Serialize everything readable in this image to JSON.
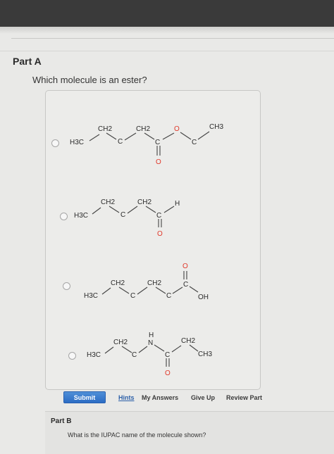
{
  "part_a": {
    "title": "Part A",
    "question": "Which molecule is an ester?",
    "options": [
      {
        "selected": false,
        "labels": {
          "h3c": "H3C",
          "ch2a": "CH2",
          "ch2b": "CH2",
          "c1": "C",
          "c2": "C",
          "o_chain": "O",
          "c3": "C",
          "ch3": "CH3",
          "o_carbonyl": "O"
        }
      },
      {
        "selected": false,
        "labels": {
          "h3c": "H3C",
          "ch2a": "CH2",
          "ch2b": "CH2",
          "c1": "C",
          "c2": "C",
          "h": "H",
          "o_carbonyl": "O"
        }
      },
      {
        "selected": false,
        "labels": {
          "h3c": "H3C",
          "ch2a": "CH2",
          "ch2b": "CH2",
          "c1": "C",
          "c2": "C",
          "c3": "C",
          "oh": "OH",
          "o_carbonyl": "O"
        }
      },
      {
        "selected": false,
        "labels": {
          "h3c": "H3C",
          "ch2a": "CH2",
          "c1": "C",
          "n": "N",
          "nh": "H",
          "c2": "C",
          "ch2b": "CH2",
          "ch3": "CH3",
          "o_carbonyl": "O"
        }
      }
    ]
  },
  "actions": {
    "submit": "Submit",
    "hints": "Hints",
    "my_answers": "My Answers",
    "give_up": "Give Up",
    "review_part": "Review Part"
  },
  "part_b": {
    "title": "Part B",
    "question": "What is the IUPAC name of the molecule shown?"
  },
  "colors": {
    "submit_button": "#3a7bd5",
    "top_bar": "#3a3a3a",
    "oxygen_atom": "#e0382a"
  }
}
